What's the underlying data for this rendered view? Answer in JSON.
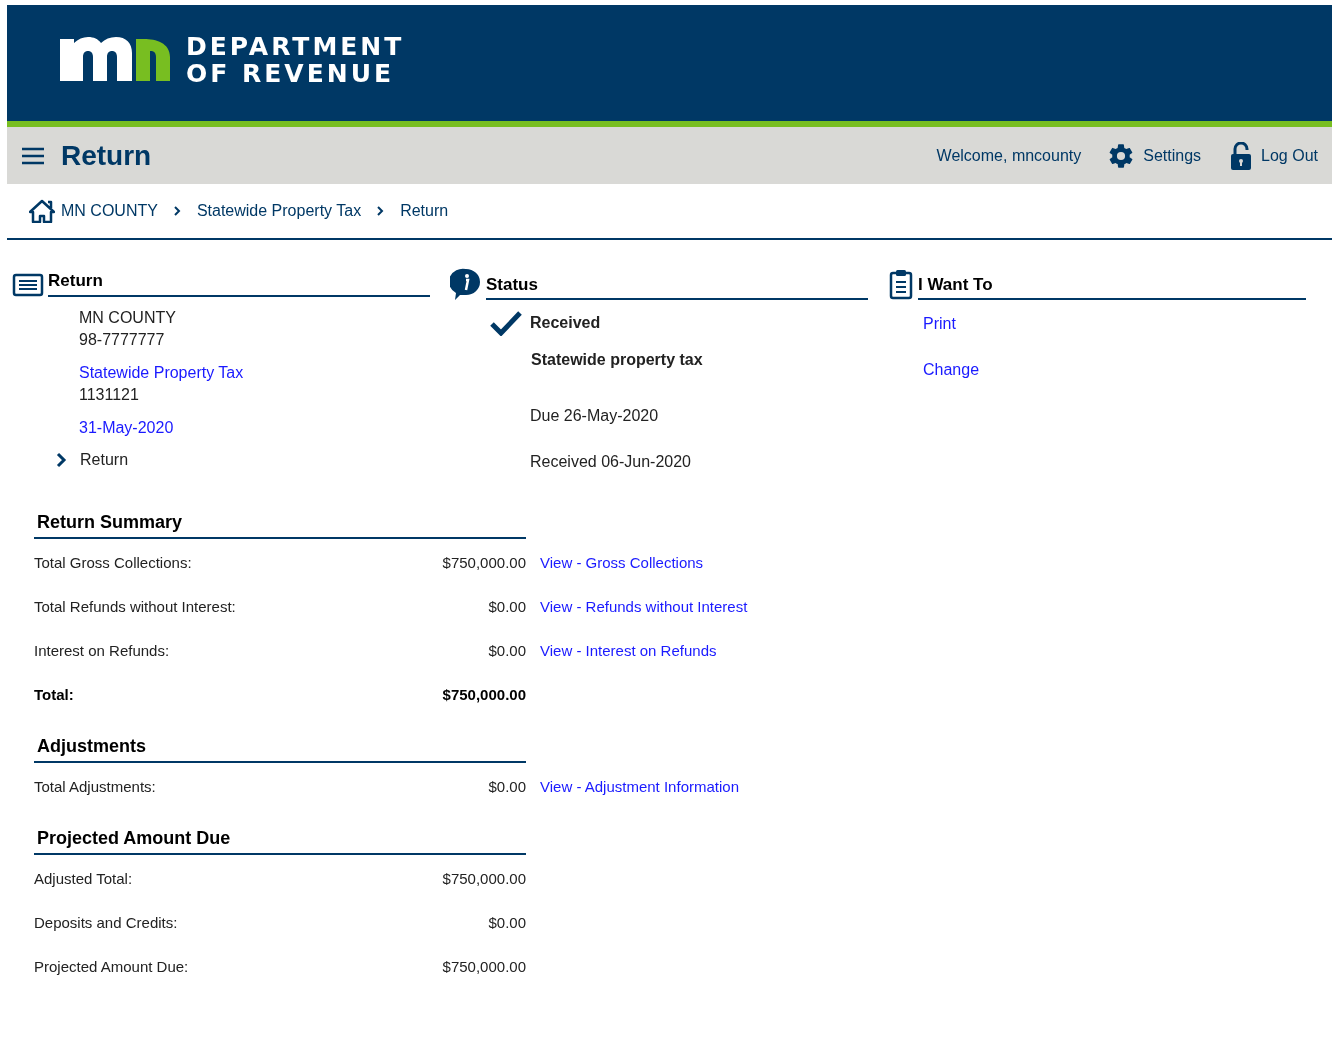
{
  "header": {
    "logo_line_1": "DEPARTMENT",
    "logo_line_2": "OF REVENUE"
  },
  "title_bar": {
    "title": "Return",
    "welcome": "Welcome, mncounty",
    "settings": "Settings",
    "logout": "Log Out"
  },
  "breadcrumbs": [
    "MN COUNTY",
    "Statewide Property Tax",
    "Return"
  ],
  "return_panel": {
    "title": "Return",
    "name": "MN COUNTY",
    "id": "98-7777777",
    "tax_link": "Statewide Property Tax",
    "tax_number": "1131121",
    "period_link": "31-May-2020",
    "expander": {
      "label": "Return",
      "expanded": false
    }
  },
  "status_panel": {
    "title": "Status",
    "status": "Received",
    "tax_type": "Statewide property tax",
    "due": "Due 26-May-2020",
    "received": "Received 06-Jun-2020"
  },
  "i_want_to": {
    "title": "I Want To",
    "links": [
      "Print",
      "Change"
    ]
  },
  "sections": [
    {
      "title": "Return Summary",
      "rows": [
        {
          "kind": "normal",
          "label": "Total Gross Collections:",
          "amount": "$750,000.00",
          "link": "View - Gross Collections"
        },
        {
          "kind": "normal",
          "label": "Total Refunds without Interest:",
          "amount": "$0.00",
          "link": "View - Refunds without Interest"
        },
        {
          "kind": "normal",
          "label": "Interest on Refunds:",
          "amount": "$0.00",
          "link": "View - Interest on Refunds"
        },
        {
          "kind": "total",
          "label": "Total:",
          "amount": "$750,000.00"
        }
      ]
    },
    {
      "title": "Adjustments",
      "rows": [
        {
          "kind": "normal",
          "label": "Total Adjustments:",
          "amount": "$0.00",
          "link": "View - Adjustment Information"
        }
      ]
    },
    {
      "title": "Projected Amount Due",
      "rows": [
        {
          "kind": "normal",
          "label": "Adjusted Total:",
          "amount": "$750,000.00"
        },
        {
          "kind": "normal",
          "label": "Deposits and Credits:",
          "amount": "$0.00"
        },
        {
          "kind": "normal",
          "label": "Projected Amount Due:",
          "amount": "$750,000.00"
        }
      ]
    }
  ]
}
